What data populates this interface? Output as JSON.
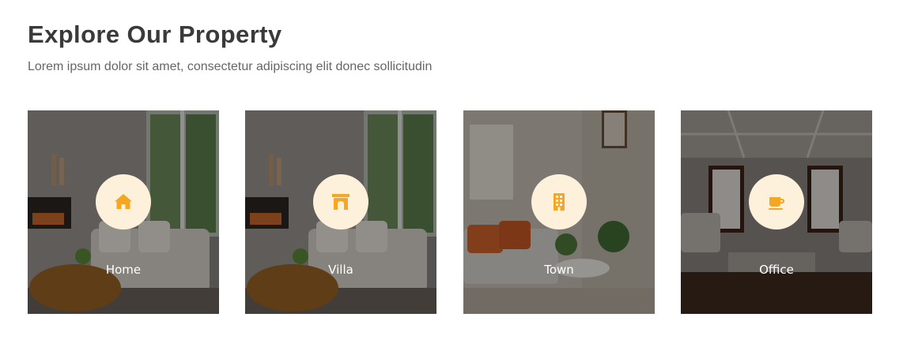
{
  "header": {
    "title": "Explore Our Property",
    "subtitle": "Lorem ipsum dolor sit amet, consectetur adipiscing elit donec sollicitudin"
  },
  "accent_color": "#f5a623",
  "icon_bg_color": "#fdf1dc",
  "cards": [
    {
      "label": "Home",
      "icon": "home-icon"
    },
    {
      "label": "Villa",
      "icon": "villa-icon"
    },
    {
      "label": "Town",
      "icon": "building-icon"
    },
    {
      "label": "Office",
      "icon": "coffee-cup-icon"
    }
  ]
}
